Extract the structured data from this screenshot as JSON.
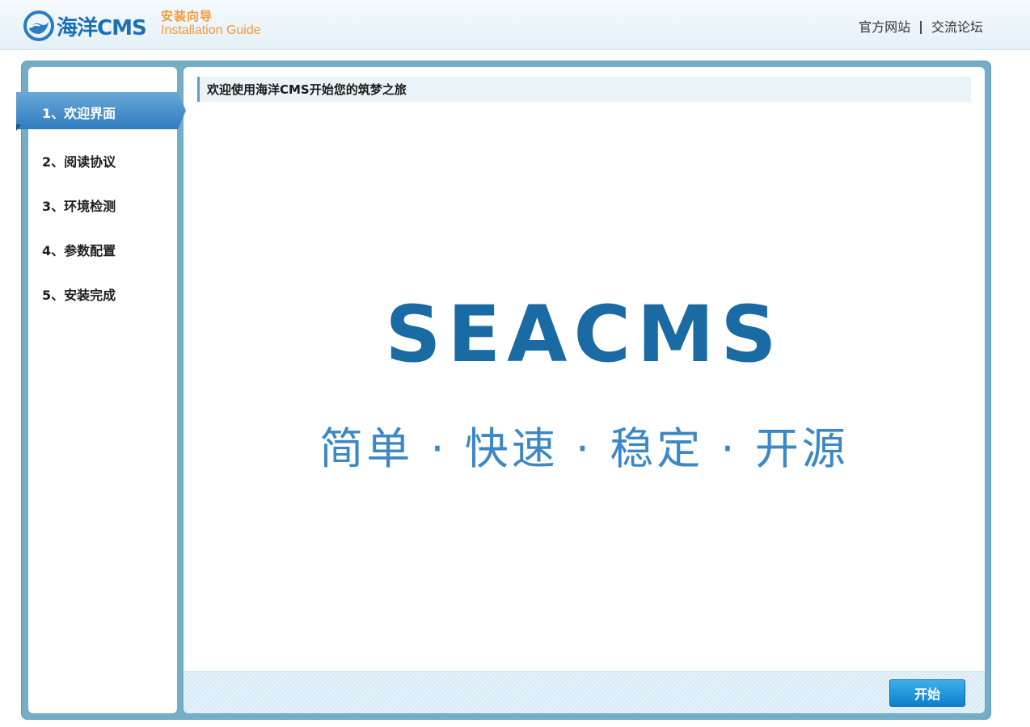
{
  "header": {
    "logo_text": "海洋CMS",
    "guide_cn": "安装向导",
    "guide_en": "Installation Guide",
    "links": [
      "官方网站",
      "交流论坛"
    ],
    "separator": "|"
  },
  "steps": [
    {
      "label": "1、欢迎界面",
      "active": true
    },
    {
      "label": "2、阅读协议",
      "active": false
    },
    {
      "label": "3、环境检测",
      "active": false
    },
    {
      "label": "4、参数配置",
      "active": false
    },
    {
      "label": "5、安装完成",
      "active": false
    }
  ],
  "content": {
    "title": "欢迎使用海洋CMS开始您的筑梦之旅",
    "brand": "SEACMS",
    "slogan": "简单 · 快速 · 稳定 · 开源"
  },
  "footer": {
    "start_label": "开始"
  },
  "colors": {
    "frame": "#74adc5",
    "accent": "#1a6aa3",
    "guide": "#f29a38",
    "button": "#0b7fcc"
  }
}
